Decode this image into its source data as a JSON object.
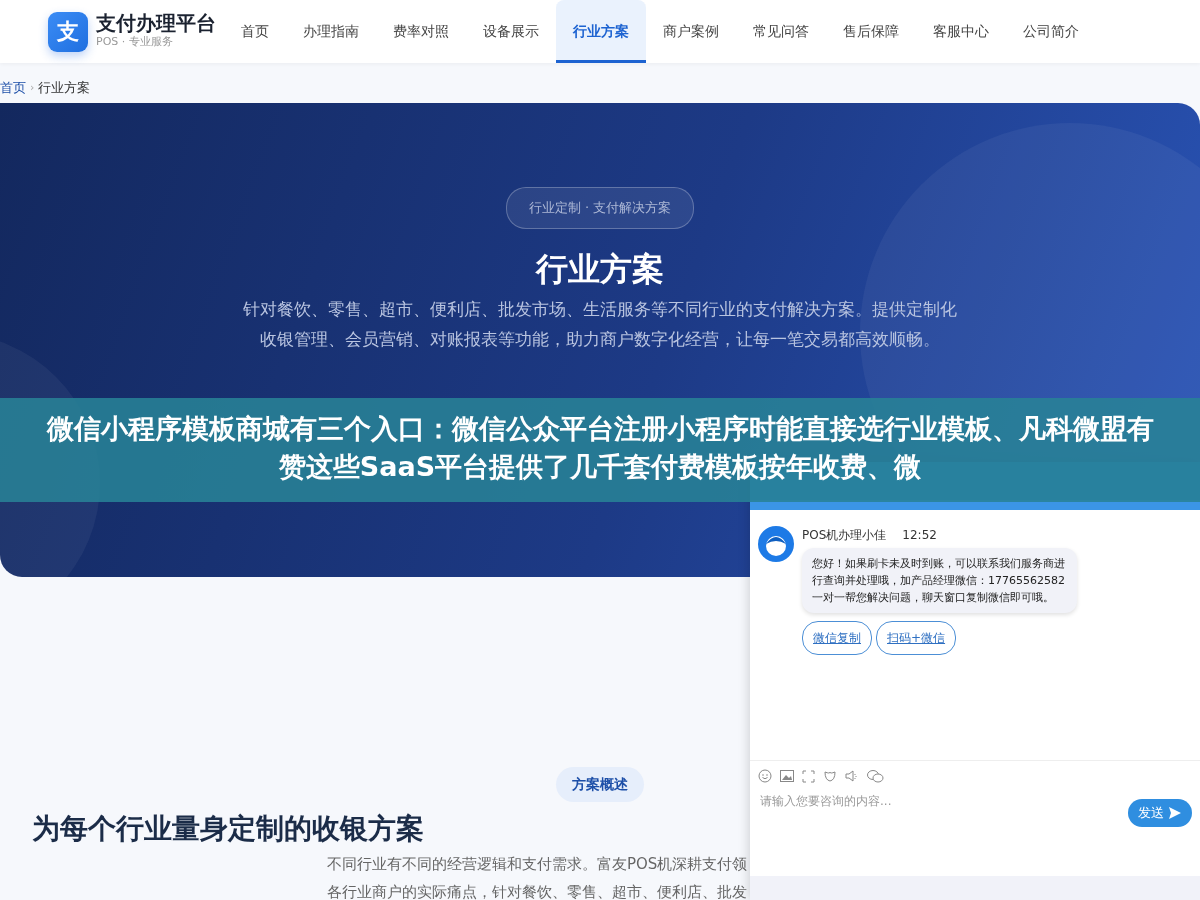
{
  "brand": {
    "logo": "支",
    "name": "支付办理平台",
    "tagline": "POS · 专业服务"
  },
  "nav": [
    {
      "label": "首页",
      "selected": false
    },
    {
      "label": "办理指南",
      "selected": false
    },
    {
      "label": "费率对照",
      "selected": false
    },
    {
      "label": "设备展示",
      "selected": false
    },
    {
      "label": "行业方案",
      "selected": true
    },
    {
      "label": "商户案例",
      "selected": false
    },
    {
      "label": "常见问答",
      "selected": false
    },
    {
      "label": "售后保障",
      "selected": false
    },
    {
      "label": "客服中心",
      "selected": false
    },
    {
      "label": "公司简介",
      "selected": false
    }
  ],
  "breadcrumb": [
    {
      "label": "首页",
      "kind": "link"
    },
    {
      "label": "›",
      "kind": "separator"
    },
    {
      "label": "行业方案",
      "kind": "current"
    }
  ],
  "hero": {
    "pill": "行业定制 · 支付解决方案",
    "title": "行业方案",
    "description": "针对餐饮、零售、超市、便利店、批发市场、生活服务等不同行业的支付解决方案。提供定制化收银管理、会员营销、对账报表等功能，助力商户数字化经营，让每一笔交易都高效顺畅。"
  },
  "overview": {
    "tag": "方案概述",
    "heading": "为每个行业量身定制的收银方案",
    "lines": [
      "不同行业有不同的经营逻辑和支付需求。富友POS机深耕支付领",
      "各行业商户的实际痛点，针对餐饮、零售、超市、便利店、批发"
    ]
  },
  "overlay_caption": "微信小程序模板商城有三个入口：微信公众平台注册小程序时能直接选行业模板、凡科微盟有赞这些SaaS平台提供了几千套付费模板按年收费、微",
  "chat": {
    "sender": "POS机办理小佳",
    "time": "12:52",
    "message": "您好！如果刷卡未及时到账，可以联系我们服务商进行查询并处理哦，加产品经理微信：17765562582 一对一帮您解决问题，聊天窗口复制微信即可哦。",
    "actions": [
      "微信复制",
      "扫码+微信"
    ],
    "input": {
      "placeholder": "请输入您要咨询的内容..."
    },
    "send": "发送"
  }
}
